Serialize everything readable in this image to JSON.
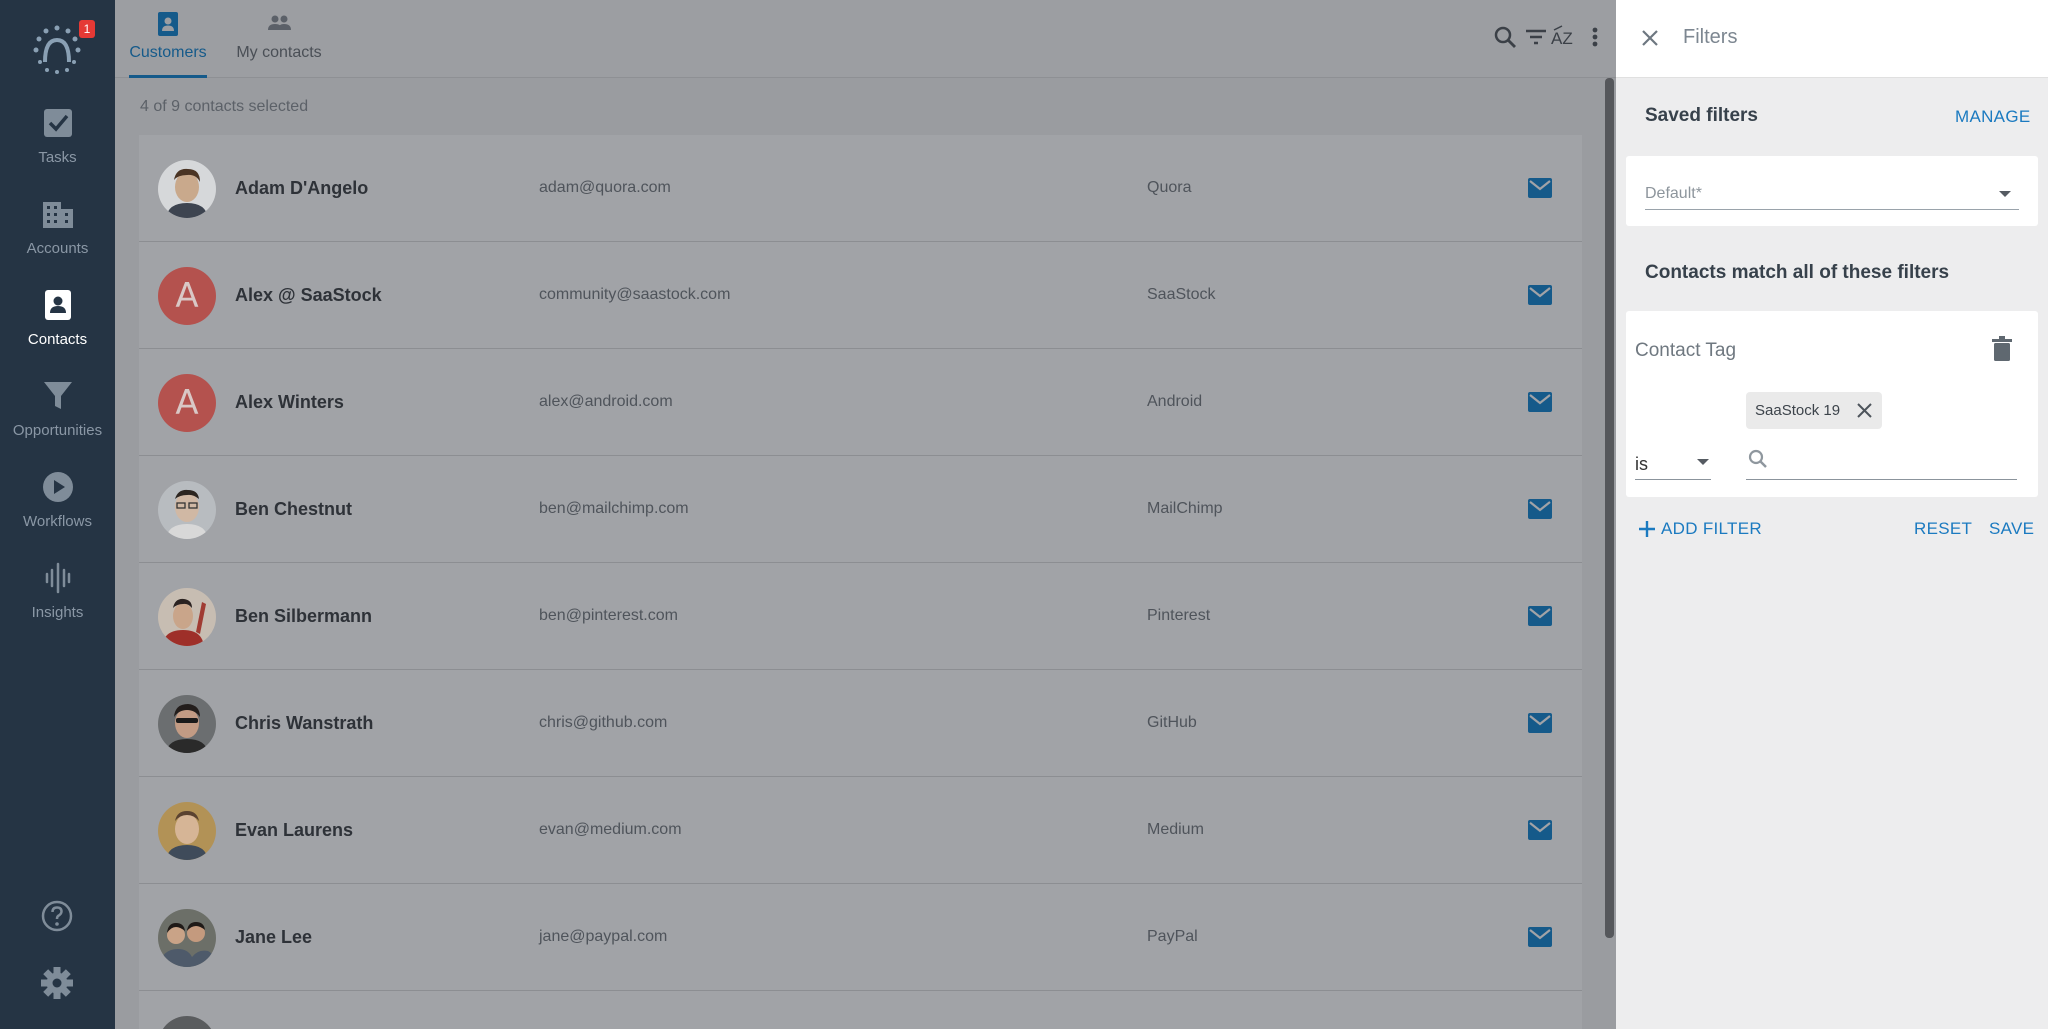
{
  "sidebar": {
    "notification_count": "1",
    "items": [
      {
        "label": "Tasks",
        "icon": "checkbox-icon"
      },
      {
        "label": "Accounts",
        "icon": "building-icon"
      },
      {
        "label": "Contacts",
        "icon": "contact-card-icon"
      },
      {
        "label": "Opportunities",
        "icon": "funnel-icon"
      },
      {
        "label": "Workflows",
        "icon": "play-circle-icon"
      },
      {
        "label": "Insights",
        "icon": "waveform-icon"
      }
    ],
    "bottom_icons": [
      "help-icon",
      "gear-icon"
    ]
  },
  "header": {
    "tabs": [
      {
        "label": "Customers",
        "icon": "contact-card-icon",
        "active": true
      },
      {
        "label": "My contacts",
        "icon": "people-icon",
        "active": false
      }
    ],
    "toolbar_icons": [
      "search-icon",
      "filter-icon",
      "sort-az-icon",
      "more-vert-icon"
    ]
  },
  "selection_text": "4 of 9 contacts selected",
  "contacts": [
    {
      "name": "Adam D'Angelo",
      "email": "adam@quora.com",
      "company": "Quora",
      "avatar": "photo"
    },
    {
      "name": "Alex @ SaaStock",
      "email": "community@saastock.com",
      "company": "SaaStock",
      "avatar": "A"
    },
    {
      "name": "Alex Winters",
      "email": "alex@android.com",
      "company": "Android",
      "avatar": "A"
    },
    {
      "name": "Ben Chestnut",
      "email": "ben@mailchimp.com",
      "company": "MailChimp",
      "avatar": "photo"
    },
    {
      "name": "Ben Silbermann",
      "email": "ben@pinterest.com",
      "company": "Pinterest",
      "avatar": "photo"
    },
    {
      "name": "Chris Wanstrath",
      "email": "chris@github.com",
      "company": "GitHub",
      "avatar": "photo"
    },
    {
      "name": "Evan Laurens",
      "email": "evan@medium.com",
      "company": "Medium",
      "avatar": "photo"
    },
    {
      "name": "Jane Lee",
      "email": "jane@paypal.com",
      "company": "PayPal",
      "avatar": "photo"
    }
  ],
  "filters_panel": {
    "title": "Filters",
    "saved_filters_label": "Saved filters",
    "manage_label": "MANAGE",
    "saved_filter_value": "Default*",
    "match_label": "Contacts match all of these filters",
    "filter": {
      "field_label": "Contact Tag",
      "operator": "is",
      "chip_label": "SaaStock 19",
      "search_placeholder": ""
    },
    "add_filter_label": "ADD FILTER",
    "reset_label": "RESET",
    "save_label": "SAVE"
  },
  "colors": {
    "sidebar_bg": "#253444",
    "accent": "#1b7ac0",
    "badge": "#e53935"
  }
}
